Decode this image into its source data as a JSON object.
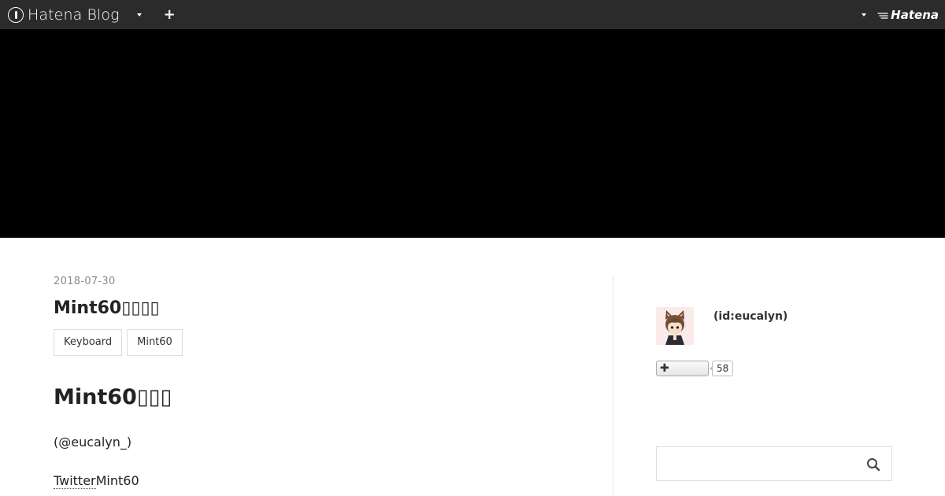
{
  "global_header": {
    "brand": "Hatena Blog",
    "hatena_label": "Hatena",
    "add_label": "+"
  },
  "entry": {
    "date": "2018-07-30",
    "title": "Mint60▯▯▯▯",
    "categories": [
      "Keyboard",
      "Mint60"
    ],
    "section_heading": "Mint60▯▯▯",
    "paragraph1": "(@eucalyn_)",
    "paragraph2_link": "Twitter",
    "paragraph2_text": "Mint60"
  },
  "sidebar": {
    "profile_id": "(id:eucalyn)",
    "reader_count": "58",
    "subscribe_label": "✚",
    "search_placeholder": ""
  },
  "colors": {
    "global_header_bg": "#2b2b2b",
    "blog_header_bg": "#000000"
  }
}
